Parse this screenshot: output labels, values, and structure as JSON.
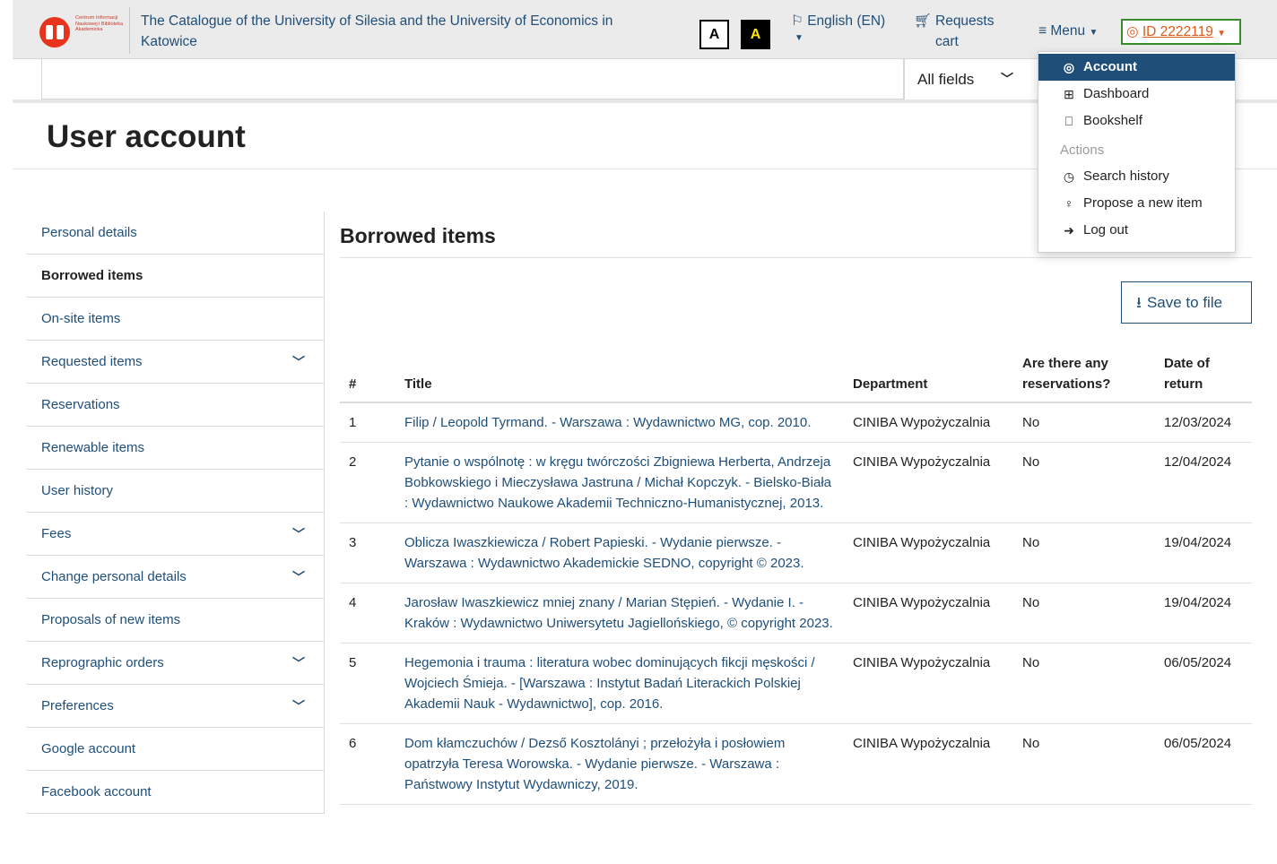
{
  "header": {
    "catalogue_title": "The Catalogue of the University of Silesia and the University of Economics in Katowice",
    "logo_text": "Centrum Informacji Naukowej i Biblioteka Akademicka",
    "contrast_normal": "A",
    "contrast_high": "A",
    "language": "English (EN)",
    "cart": "Requests cart",
    "menu": "Menu",
    "user_id": "ID 2222119",
    "accent_color": "#1f4e79",
    "id_color": "#e05a1c"
  },
  "search": {
    "value": "",
    "field_select": "All fields"
  },
  "page_title": "User account",
  "sidebar": {
    "items": [
      {
        "label": "Personal details",
        "expandable": false
      },
      {
        "label": "Borrowed items",
        "expandable": false,
        "active": true
      },
      {
        "label": "On-site items",
        "expandable": false
      },
      {
        "label": "Requested items",
        "expandable": true
      },
      {
        "label": "Reservations",
        "expandable": false
      },
      {
        "label": "Renewable items",
        "expandable": false
      },
      {
        "label": "User history",
        "expandable": false
      },
      {
        "label": "Fees",
        "expandable": true
      },
      {
        "label": "Change personal details",
        "expandable": true
      },
      {
        "label": "Proposals of new items",
        "expandable": false
      },
      {
        "label": "Reprographic orders",
        "expandable": true
      },
      {
        "label": "Preferences",
        "expandable": true
      },
      {
        "label": "Google account",
        "expandable": false
      },
      {
        "label": "Facebook account",
        "expandable": false
      }
    ]
  },
  "main": {
    "section_title": "Borrowed items",
    "save_button": "Save to file",
    "table": {
      "headers": [
        "#",
        "Title",
        "Department",
        "Are there any reservations?",
        "Date of return"
      ],
      "rows": [
        [
          "1",
          "Filip / Leopold Tyrmand. - Warszawa : Wydawnictwo MG, cop. 2010.",
          "CINIBA Wypożyczalnia",
          "No",
          "12/03/2024"
        ],
        [
          "2",
          "Pytanie o wspólnotę : w kręgu twórczości Zbigniewa Herberta, Andrzeja Bobkowskiego i Mieczysława Jastruna / Michał Kopczyk. - Bielsko-Biała : Wydawnictwo Naukowe Akademii Techniczno-Humanistycznej, 2013.",
          "CINIBA Wypożyczalnia",
          "No",
          "12/04/2024"
        ],
        [
          "3",
          "Oblicza Iwaszkiewicza / Robert Papieski. - Wydanie pierwsze. - Warszawa : Wydawnictwo Akademickie SEDNO, copyright © 2023.",
          "CINIBA Wypożyczalnia",
          "No",
          "19/04/2024"
        ],
        [
          "4",
          "Jarosław Iwaszkiewicz mniej znany / Marian Stępień. - Wydanie I. - Kraków : Wydawnictwo Uniwersytetu Jagiellońskiego, © copyright 2023.",
          "CINIBA Wypożyczalnia",
          "No",
          "19/04/2024"
        ],
        [
          "5",
          "Hegemonia i trauma : literatura wobec dominujących fikcji męskości / Wojciech Śmieja. - [Warszawa : Instytut Badań Literackich Polskiej Akademii Nauk - Wydawnictwo], cop. 2016.",
          "CINIBA Wypożyczalnia",
          "No",
          "06/05/2024"
        ],
        [
          "6",
          "Dom kłamczuchów / Dezső Kosztolányi ; przełożyła i posłowiem opatrzyła Teresa Worowska. - Wydanie pierwsze. - Warszawa : Państwowy Instytut Wydawniczy, 2019.",
          "CINIBA Wypożyczalnia",
          "No",
          "06/05/2024"
        ]
      ]
    }
  },
  "dropdown": {
    "items": [
      {
        "label": "Account",
        "icon": "user-circle-icon",
        "selected": true
      },
      {
        "label": "Dashboard",
        "icon": "table-icon"
      },
      {
        "label": "Bookshelf",
        "icon": "bookmark-icon"
      }
    ],
    "actions_heading": "Actions",
    "actions": [
      {
        "label": "Search history",
        "icon": "clock-icon"
      },
      {
        "label": "Propose a new item",
        "icon": "lightbulb-icon"
      },
      {
        "label": "Log out",
        "icon": "sign-out-icon"
      }
    ]
  }
}
